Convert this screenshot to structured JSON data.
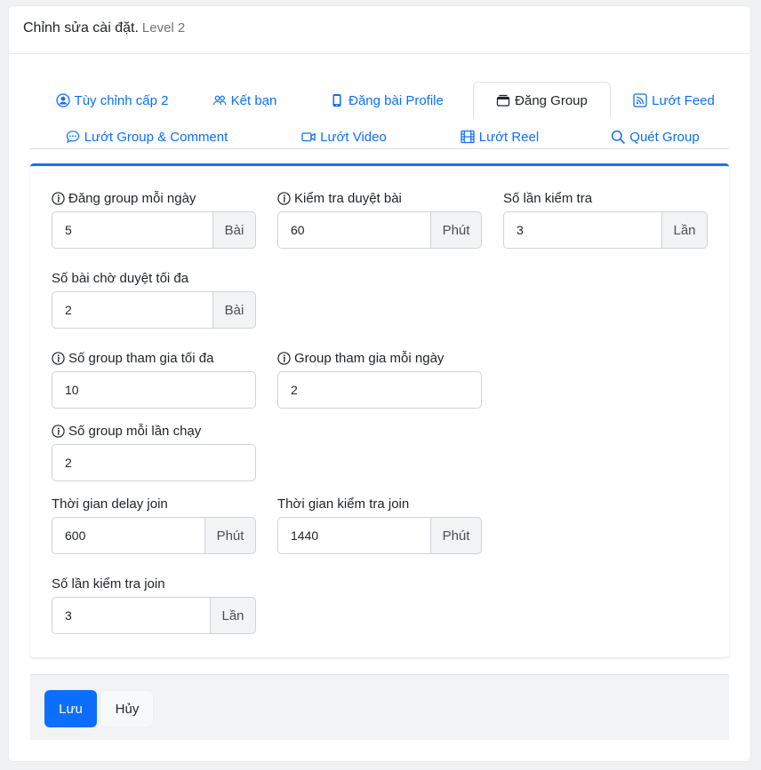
{
  "header": {
    "title": "Chỉnh sửa cài đặt.",
    "subtitle": "Level 2"
  },
  "tabs": [
    {
      "label": "Tùy chỉnh cấp 2",
      "icon": "user-circle-icon"
    },
    {
      "label": "Kết bạn",
      "icon": "people-icon"
    },
    {
      "label": "Đăng bài Profile",
      "icon": "phone-icon"
    },
    {
      "label": "Đăng Group",
      "icon": "window-stack-icon",
      "active": true
    },
    {
      "label": "Lướt Feed",
      "icon": "rss-icon"
    },
    {
      "label": "Lướt Group & Comment",
      "icon": "chat-dots-icon"
    },
    {
      "label": "Lướt Video",
      "icon": "camera-video-icon"
    },
    {
      "label": "Lướt Reel",
      "icon": "film-icon"
    },
    {
      "label": "Quét Group",
      "icon": "search-icon"
    }
  ],
  "fields": {
    "post_group_per_day": {
      "label": "Đăng group mỗi ngày",
      "value": "5",
      "unit": "Bài"
    },
    "check_approval": {
      "label": "Kiểm tra duyệt bài",
      "value": "60",
      "unit": "Phút"
    },
    "check_count": {
      "label": "Số lần kiểm tra",
      "value": "3",
      "unit": "Lần"
    },
    "max_pending_posts": {
      "label": "Số bài chờ duyệt tối đa",
      "value": "2",
      "unit": "Bài"
    },
    "max_groups_join": {
      "label": "Số group tham gia tối đa",
      "value": "10"
    },
    "groups_join_per_day": {
      "label": "Group tham gia mỗi ngày",
      "value": "2"
    },
    "groups_per_run": {
      "label": "Số group mỗi lần chạy",
      "value": "2"
    },
    "join_delay": {
      "label": "Thời gian delay join",
      "value": "600",
      "unit": "Phút"
    },
    "join_check_time": {
      "label": "Thời gian kiểm tra join",
      "value": "1440",
      "unit": "Phút"
    },
    "join_check_count": {
      "label": "Số lần kiểm tra join",
      "value": "3",
      "unit": "Lần"
    }
  },
  "footer": {
    "save_label": "Lưu",
    "cancel_label": "Hủy"
  },
  "colors": {
    "accent": "#0d6efd",
    "panel_border": "#1a73e8"
  }
}
